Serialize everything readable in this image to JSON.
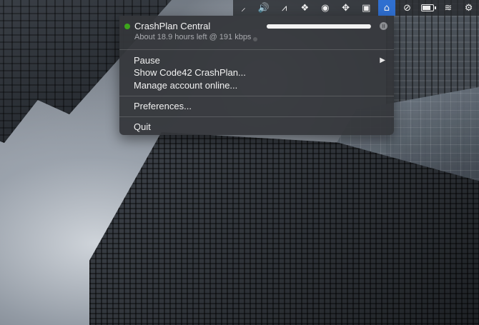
{
  "menubar": {
    "items": [
      {
        "name": "signal-icon",
        "glyph": "⸝"
      },
      {
        "name": "volume-icon",
        "glyph": "🔊"
      },
      {
        "name": "alfred-icon",
        "glyph": "⩘"
      },
      {
        "name": "dropbox-icon",
        "glyph": "❖"
      },
      {
        "name": "cloud-app-icon",
        "glyph": "◉"
      },
      {
        "name": "move-arrows-icon",
        "glyph": "✥"
      },
      {
        "name": "display-icon",
        "glyph": "▣"
      },
      {
        "name": "crashplan-home-icon",
        "glyph": "⌂"
      },
      {
        "name": "blocked-icon",
        "glyph": "⊘"
      },
      {
        "name": "battery-icon",
        "glyph": ""
      },
      {
        "name": "wifi-icon",
        "glyph": "≋"
      },
      {
        "name": "settings-gear-icon",
        "glyph": "⚙"
      }
    ],
    "battery_level": 0.65,
    "accent_color": "#2f6fd0"
  },
  "menu": {
    "title": "CrashPlan Central",
    "subtitle": "About 18.9 hours left @ 191 kbps",
    "progress": 0.99,
    "status_color": "#3da51c",
    "pause_glyph": "II",
    "items": {
      "pause": "Pause",
      "show": "Show Code42 CrashPlan...",
      "manage": "Manage account online...",
      "preferences": "Preferences...",
      "quit": "Quit"
    },
    "submenu_arrow": "▶"
  }
}
